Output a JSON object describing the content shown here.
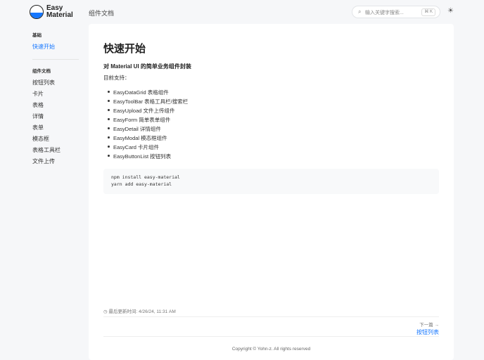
{
  "header": {
    "brand_line1": "Easy",
    "brand_line2": "Material",
    "nav_title": "组件文档",
    "search_placeholder": "输入关键字搜索...",
    "search_shortcut": "⌘ K",
    "search_icon": "search-icon",
    "theme_icon": "sun-icon"
  },
  "sidebar": {
    "section1": "基础",
    "section1_items": [
      "快速开始"
    ],
    "section2": "组件文档",
    "section2_items": [
      "按钮列表",
      "卡片",
      "表格",
      "详情",
      "表单",
      "模态框",
      "表格工具栏",
      "文件上传"
    ]
  },
  "content": {
    "title": "快速开始",
    "subtitle": "对 Material UI 的简单业务组件封装",
    "lead": "目前支持：",
    "items": [
      "EasyDataGrid 表格组件",
      "EasyToolBar 表格工具栏/搜索栏",
      "EasyUpload 文件上传组件",
      "EasyForm 简单表单组件",
      "EasyDetail 详情组件",
      "EasyModal 模态框组件",
      "EasyCard 卡片组件",
      "EasyButtonList 按钮列表"
    ],
    "code": [
      "npm install easy-material",
      "yarn add easy-material"
    ],
    "last_updated": "最后更新时间: 4/26/24, 11:31 AM",
    "next_label": "下一篇 →",
    "next_link": "按钮列表"
  },
  "footer": {
    "copyright": "Copyright © Yohn-z. All rights reserved"
  },
  "colors": {
    "accent": "#1677ff"
  }
}
